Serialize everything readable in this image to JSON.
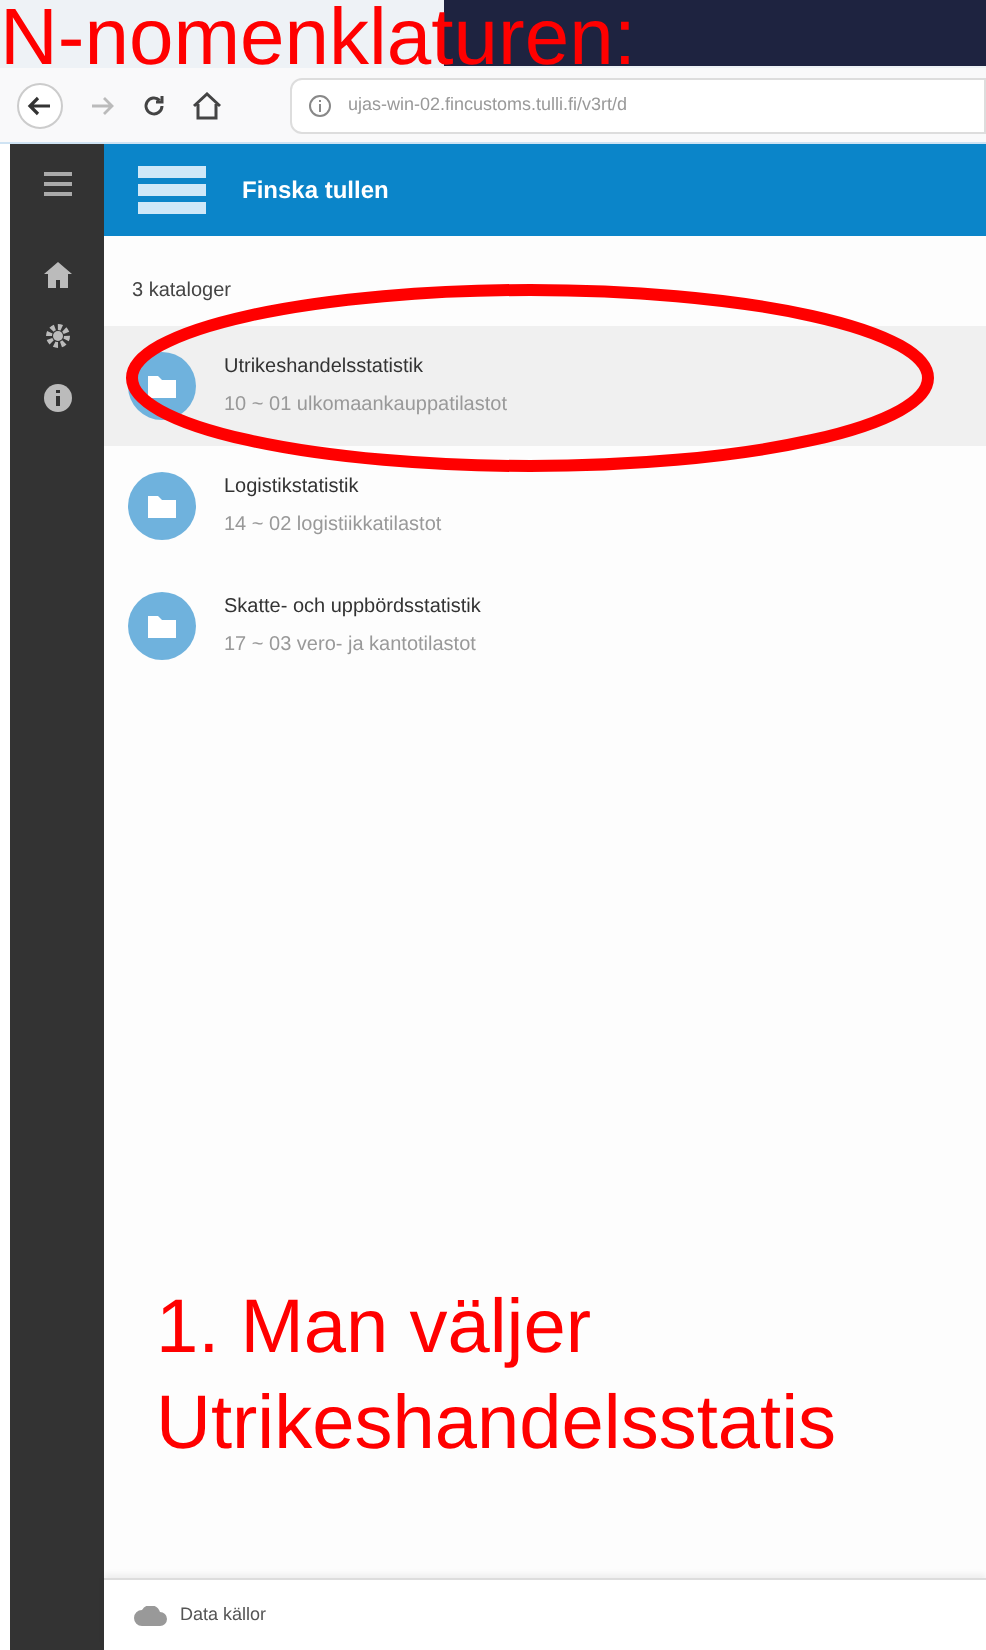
{
  "slide_title": "N-nomenklaturen:",
  "browser": {
    "url": "ujas-win-02.fincustoms.tulli.fi/v3rt/d"
  },
  "app": {
    "title": "Finska tullen",
    "count": "3 kataloger",
    "catalogs": [
      {
        "title": "Utrikeshandelsstatistik",
        "subtitle": "10 ~ 01 ulkomaankauppatilastot",
        "selected": true
      },
      {
        "title": "Logistikstatistik",
        "subtitle": "14 ~ 02 logistiikkatilastot",
        "selected": false
      },
      {
        "title": "Skatte- och uppbördsstatistik",
        "subtitle": "17 ~ 03 vero- ja kantotilastot",
        "selected": false
      }
    ],
    "footer": "Data källor"
  },
  "annotation": {
    "lines": [
      "1. Man väljer",
      "Utrikeshandelsstatis"
    ]
  }
}
